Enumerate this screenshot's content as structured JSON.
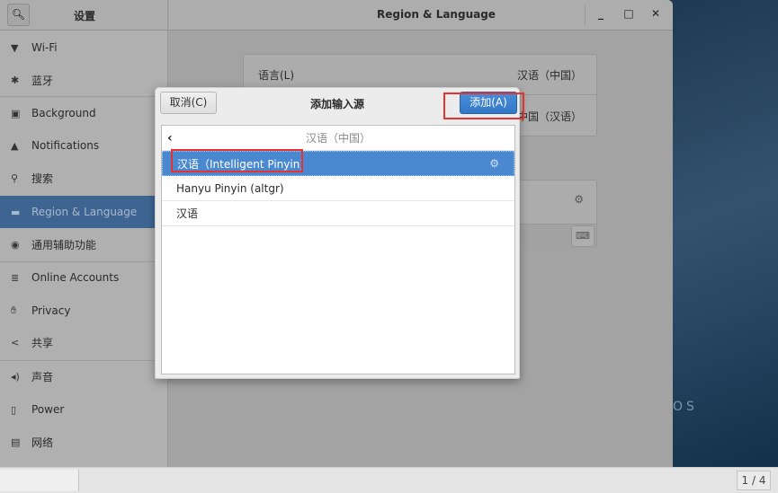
{
  "window": {
    "sidebar_title": "设置",
    "panel_title": "Region & Language",
    "controls": [
      "minimize-icon",
      "maximize-icon",
      "close-icon"
    ]
  },
  "sidebar": {
    "items": [
      {
        "label": "Wi-Fi",
        "icon": "wifi-icon"
      },
      {
        "label": "蓝牙",
        "icon": "bluetooth-icon"
      },
      {
        "label": "Background",
        "icon": "background-icon"
      },
      {
        "label": "Notifications",
        "icon": "bell-icon"
      },
      {
        "label": "搜索",
        "icon": "search-icon"
      },
      {
        "label": "Region & Language",
        "icon": "flag-icon",
        "selected": true
      },
      {
        "label": "通用辅助功能",
        "icon": "accessibility-icon"
      },
      {
        "label": "Online Accounts",
        "icon": "online-accounts-icon"
      },
      {
        "label": "Privacy",
        "icon": "hand-icon"
      },
      {
        "label": "共享",
        "icon": "share-icon"
      },
      {
        "label": "声音",
        "icon": "speaker-icon"
      },
      {
        "label": "Power",
        "icon": "power-icon"
      },
      {
        "label": "网络",
        "icon": "network-icon"
      }
    ]
  },
  "main": {
    "language_label": "语言(L)",
    "language_value": "汉语（中国）",
    "formats_value": "中国（汉语）"
  },
  "dialog": {
    "cancel": "取消(C)",
    "title": "添加输入源",
    "add": "添加(A)",
    "back_header": "汉语（中国）",
    "items": [
      "汉语（Intelligent Pinyin)",
      "Hanyu Pinyin (altgr)",
      "汉语"
    ]
  },
  "desktop": {
    "watermark": "OS"
  },
  "taskbar": {
    "pager": "1 / 4"
  },
  "colors": {
    "accent": "#4a89d0",
    "highlight": "#e8322f",
    "selected_sidebar": "#3e6592"
  }
}
